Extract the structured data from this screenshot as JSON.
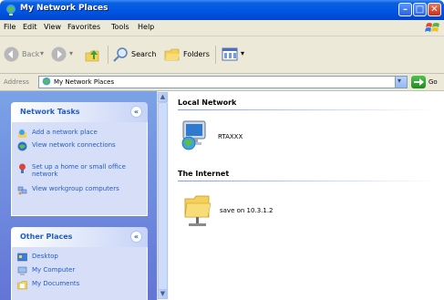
{
  "window": {
    "title": "My Network Places"
  },
  "menu": [
    "File",
    "Edit",
    "View",
    "Favorites",
    "Tools",
    "Help"
  ],
  "toolbar": {
    "back": "Back",
    "search": "Search",
    "folders": "Folders"
  },
  "address": {
    "label": "Address",
    "value": "My Network Places",
    "go": "Go"
  },
  "network_tasks": {
    "title": "Network Tasks",
    "items": [
      {
        "label": "Add a network place",
        "icon": "add-network-place-icon"
      },
      {
        "label": "View network connections",
        "icon": "network-connections-icon"
      },
      {
        "label": "Set up a home or small office network",
        "icon": "home-network-icon"
      },
      {
        "label": "View workgroup computers",
        "icon": "workgroup-icon"
      }
    ]
  },
  "other_places": {
    "title": "Other Places",
    "items": [
      {
        "label": "Desktop",
        "icon": "desktop-icon"
      },
      {
        "label": "My Computer",
        "icon": "my-computer-icon"
      },
      {
        "label": "My Documents",
        "icon": "my-documents-icon"
      }
    ]
  },
  "groups": [
    {
      "title": "Local Network",
      "items": [
        {
          "label": "RTAXXX",
          "icon": "network-computer-icon"
        }
      ]
    },
    {
      "title": "The Internet",
      "items": [
        {
          "label": "save on 10.3.1.2",
          "icon": "network-folder-icon"
        }
      ]
    }
  ],
  "colors": {
    "titlebar": "#0054e3",
    "taskpane": "#6f8fdf",
    "link": "#215dc6"
  }
}
